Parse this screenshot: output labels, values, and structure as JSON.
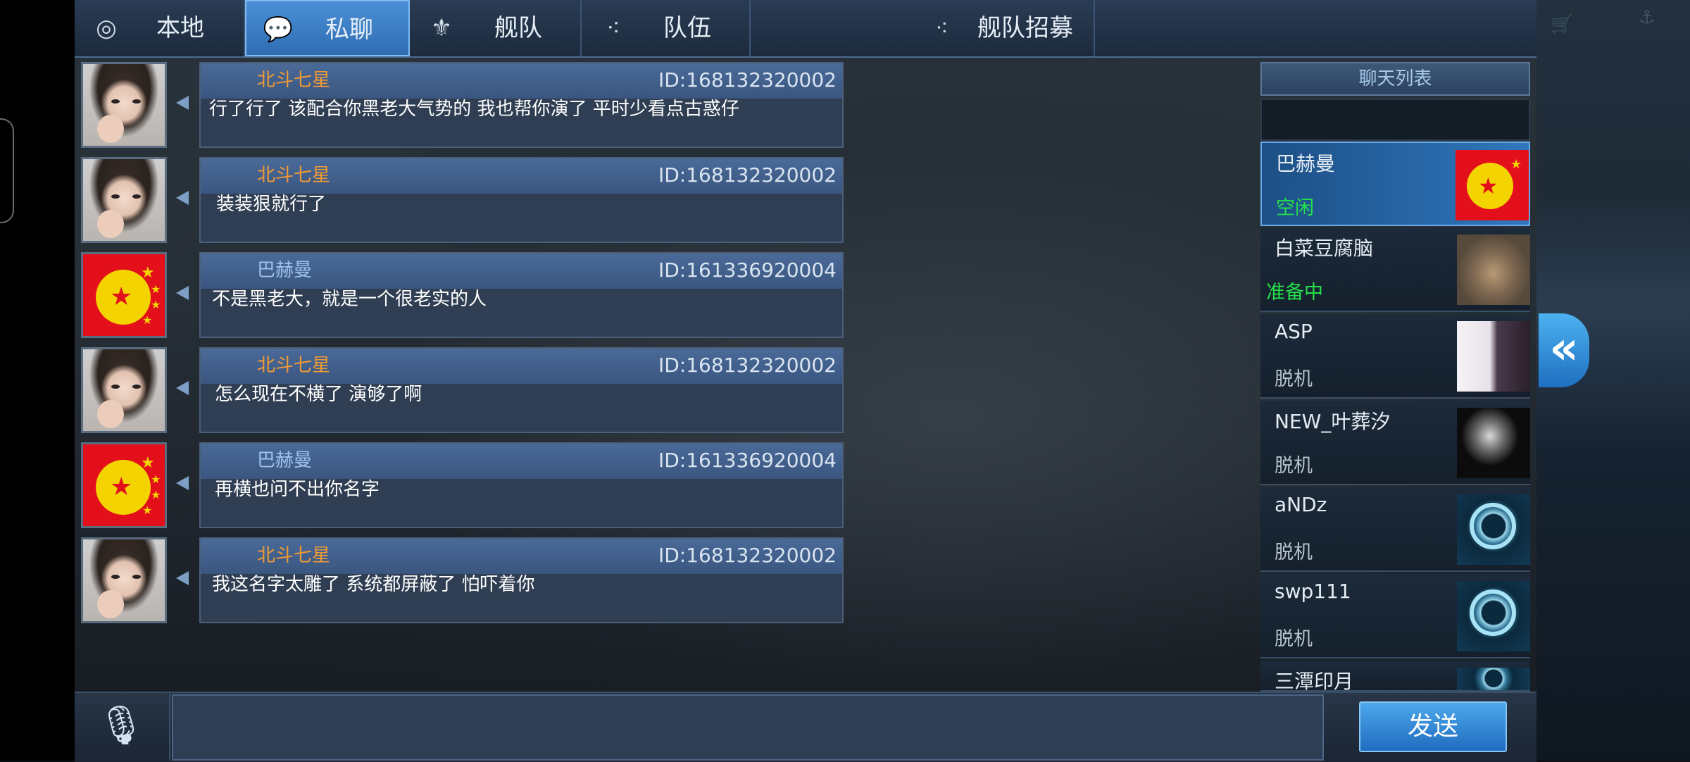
{
  "tabs": [
    {
      "label": "本地",
      "icon": "globe-icon"
    },
    {
      "label": "私聊",
      "icon": "chat-bubble-icon"
    },
    {
      "label": "舰队",
      "icon": "fleet-emblem-icon"
    },
    {
      "label": "队伍",
      "icon": "team-dots-icon"
    }
  ],
  "recruit_tab": {
    "label": "舰队招募",
    "icon": "team-dots-icon"
  },
  "messages": [
    {
      "name": "北斗七星",
      "id": "ID:168132320002",
      "text": "行了行了 该配合你黑老大气势的 我也帮你演了 平时少看点古惑仔",
      "avatar": "girl-avatar",
      "name_color": "orange"
    },
    {
      "name": "北斗七星",
      "id": "ID:168132320002",
      "text": "装装狠就行了",
      "avatar": "girl-avatar",
      "name_color": "orange"
    },
    {
      "name": "巴赫曼",
      "id": "ID:161336920004",
      "text": "不是黑老大，就是一个很老实的人",
      "avatar": "flag-avatar",
      "name_color": "blue"
    },
    {
      "name": "北斗七星",
      "id": "ID:168132320002",
      "text": "怎么现在不横了 演够了啊",
      "avatar": "girl-avatar",
      "name_color": "orange"
    },
    {
      "name": "巴赫曼",
      "id": "ID:161336920004",
      "text": "再横也问不出你名字",
      "avatar": "flag-avatar",
      "name_color": "blue"
    },
    {
      "name": "北斗七星",
      "id": "ID:168132320002",
      "text": "我这名字太雕了 系统都屏蔽了 怕吓着你",
      "avatar": "girl-avatar",
      "name_color": "orange"
    }
  ],
  "chat_list": {
    "title": "聊天列表",
    "contacts": [
      {
        "name": "巴赫曼",
        "status": "空闲",
        "selected": true
      },
      {
        "name": "白菜豆腐脑",
        "status": "准备中"
      },
      {
        "name": "ASP",
        "status": "脱机"
      },
      {
        "name": "NEW_叶葬汐",
        "status": "脱机"
      },
      {
        "name": "aNDz",
        "status": "脱机"
      },
      {
        "name": "swp111",
        "status": "脱机"
      },
      {
        "name": "三潭印月",
        "status": ""
      }
    ]
  },
  "bottom": {
    "send_label": "发送",
    "mic_icon": "microphone-icon"
  },
  "colors": {
    "orange_name": "#f19a35",
    "blue_name": "#9ec3ee",
    "status_green": "#24e14b",
    "accent_blue": "#2f77bd"
  }
}
